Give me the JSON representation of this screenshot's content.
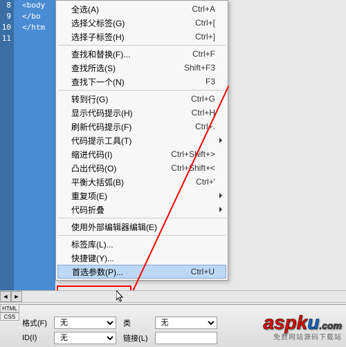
{
  "gutter_lines": [
    "8",
    "9",
    "10",
    "11"
  ],
  "code_lines": [
    "<body",
    "</bo",
    "</htm",
    ""
  ],
  "menu": [
    {
      "type": "item",
      "label": "全选(A)",
      "shortcut": "Ctrl+A"
    },
    {
      "type": "item",
      "label": "选择父标签(G)",
      "shortcut": "Ctrl+["
    },
    {
      "type": "item",
      "label": "选择子标签(H)",
      "shortcut": "Ctrl+]"
    },
    {
      "type": "sep"
    },
    {
      "type": "item",
      "label": "查找和替换(F)...",
      "shortcut": "Ctrl+F"
    },
    {
      "type": "item",
      "label": "查找所选(S)",
      "shortcut": "Shift+F3"
    },
    {
      "type": "item",
      "label": "查找下一个(N)",
      "shortcut": "F3"
    },
    {
      "type": "sep"
    },
    {
      "type": "item",
      "label": "转到行(G)",
      "shortcut": "Ctrl+G"
    },
    {
      "type": "item",
      "label": "显示代码提示(H)",
      "shortcut": "Ctrl+H"
    },
    {
      "type": "item",
      "label": "刷新代码提示(F)",
      "shortcut": "Ctrl+."
    },
    {
      "type": "item",
      "label": "代码提示工具(T)",
      "submenu": true
    },
    {
      "type": "item",
      "label": "缩进代码(I)",
      "shortcut": "Ctrl+Shift+>"
    },
    {
      "type": "item",
      "label": "凸出代码(O)",
      "shortcut": "Ctrl+Shift+<"
    },
    {
      "type": "item",
      "label": "平衡大括弧(B)",
      "shortcut": "Ctrl+'"
    },
    {
      "type": "item",
      "label": "重复项(E)",
      "submenu": true
    },
    {
      "type": "item",
      "label": "代码折叠",
      "submenu": true
    },
    {
      "type": "sep"
    },
    {
      "type": "item",
      "label": "使用外部编辑器编辑(E)"
    },
    {
      "type": "sep"
    },
    {
      "type": "item",
      "label": "标签库(L)..."
    },
    {
      "type": "item",
      "label": "快捷键(Y)..."
    },
    {
      "type": "item",
      "label": "首选参数(P)...",
      "shortcut": "Ctrl+U",
      "highlight": true
    }
  ],
  "props": {
    "format_label": "格式(F)",
    "format_value": "无",
    "id_label": "ID(I)",
    "id_value": "无",
    "class_label": "类",
    "class_value": "无",
    "link_label": "链接(L)"
  },
  "tabs": {
    "html": "HTML",
    "css": "CSS"
  },
  "watermark": {
    "logo_a": "aspk",
    "logo_u": "u",
    "dotcom": ".com",
    "sub": "免费网站源码下载站"
  },
  "scroll": {
    "left": "◄",
    "right": "►"
  }
}
